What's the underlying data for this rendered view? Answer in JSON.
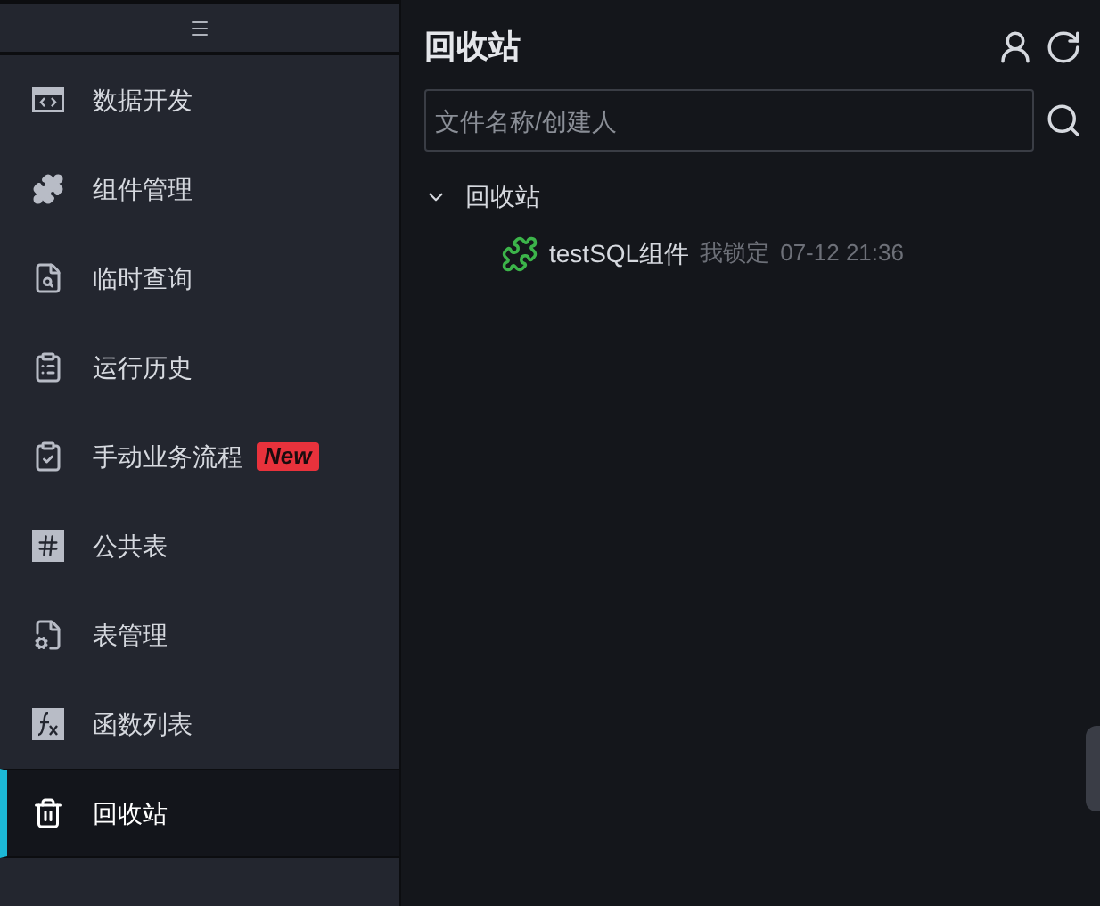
{
  "sidebar": {
    "items": [
      {
        "kind": "code",
        "label": "数据开发",
        "selected": false
      },
      {
        "kind": "puzzle",
        "label": "组件管理",
        "selected": false
      },
      {
        "kind": "query",
        "label": "临时查询",
        "selected": false
      },
      {
        "kind": "clipboard",
        "label": "运行历史",
        "selected": false
      },
      {
        "kind": "check",
        "label": "手动业务流程",
        "selected": false,
        "badge": "New"
      },
      {
        "kind": "hash",
        "label": "公共表",
        "selected": false
      },
      {
        "kind": "table",
        "label": "表管理",
        "selected": false
      },
      {
        "kind": "fx",
        "label": "函数列表",
        "selected": false
      },
      {
        "kind": "trash",
        "label": "回收站",
        "selected": true
      }
    ]
  },
  "panel": {
    "title": "回收站",
    "search": {
      "placeholder": "文件名称/创建人"
    },
    "tree": [
      {
        "label": "回收站",
        "expanded": true,
        "children": [
          {
            "name": "testSQL组件",
            "lock": "我锁定",
            "time": "07-12 21:36"
          }
        ]
      }
    ]
  }
}
